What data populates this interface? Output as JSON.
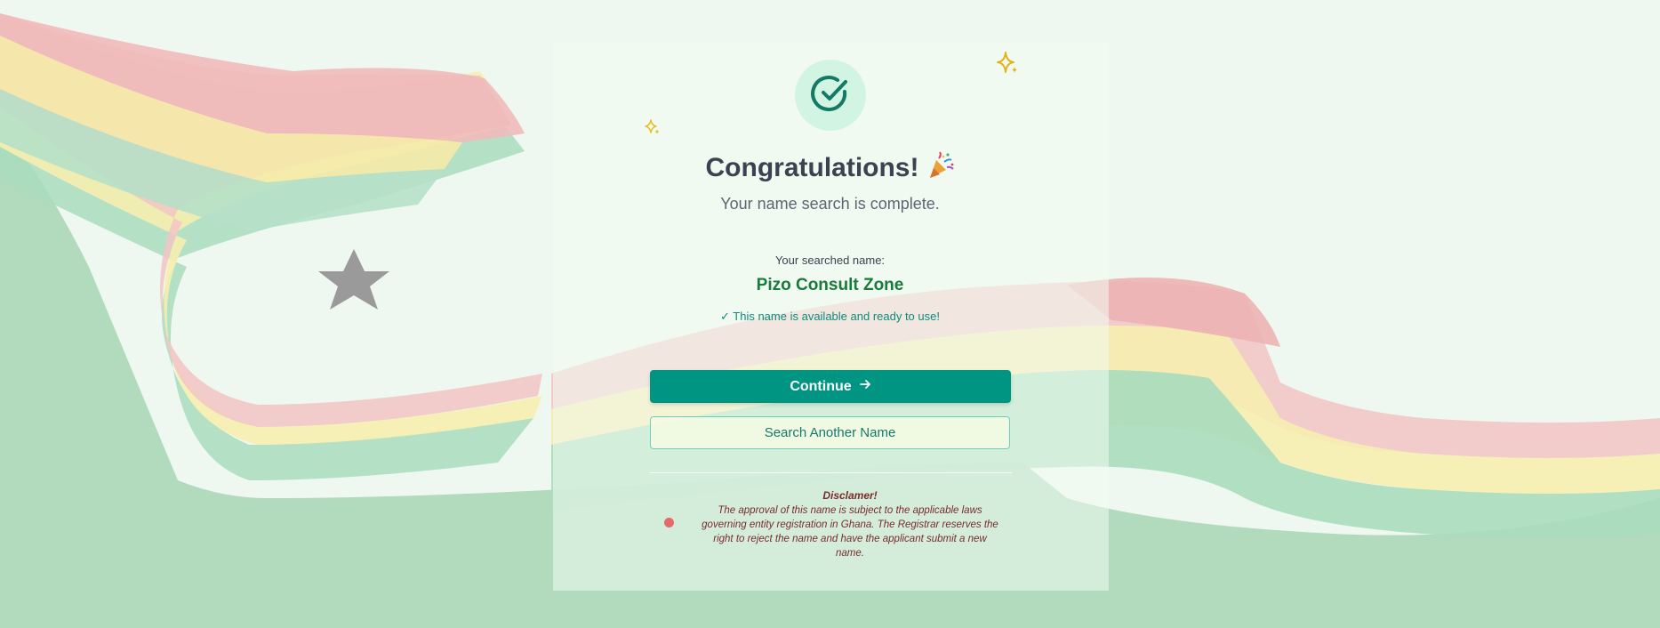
{
  "success": {
    "title": "Congratulations!",
    "subtitle": "Your name search is complete."
  },
  "result": {
    "label": "Your searched name:",
    "name": "Pizo Consult Zone",
    "status": "✓ This name is available and ready to use!"
  },
  "actions": {
    "continue_label": "Continue",
    "search_another_label": "Search Another Name"
  },
  "disclaimer": {
    "title": "Disclamer!",
    "text": "The approval of this name is subject to the applicable laws governing entity registration in Ghana. The Registrar reserves the right to reject the name and have the applicant submit a new name."
  },
  "colors": {
    "primary": "#009482",
    "success_text": "#1a7a3a",
    "status_text": "#0c8c7b",
    "disclaimer_text": "#7a2a2a",
    "flag_red": "#f2b8b8",
    "flag_yellow": "#f6eeb0",
    "flag_green": "#a9dcbd"
  },
  "icons": {
    "success": "check-circle-icon",
    "continue": "arrow-right-icon",
    "info": "info-dot-icon",
    "decorations": [
      "sparkle-icon",
      "party-popper-icon"
    ]
  }
}
